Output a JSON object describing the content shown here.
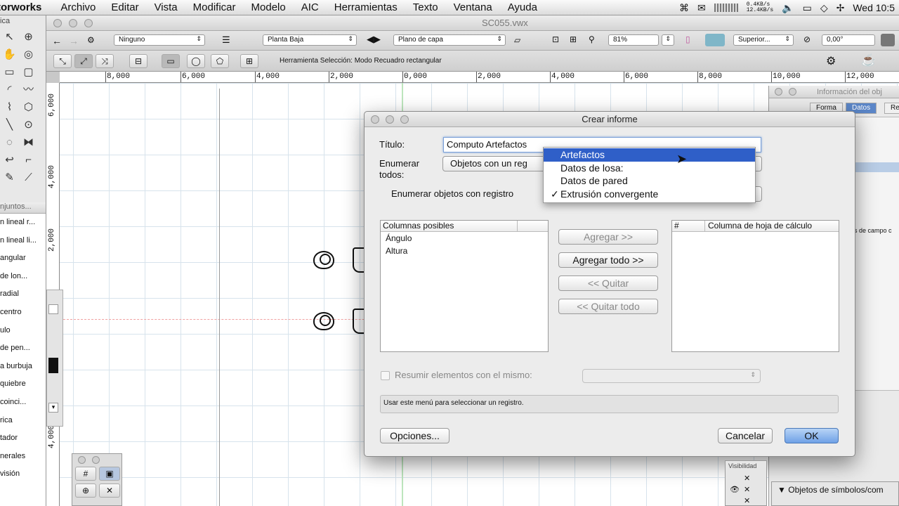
{
  "menubar": {
    "app": "torworks",
    "items": [
      "Archivo",
      "Editar",
      "Vista",
      "Modificar",
      "Modelo",
      "AIC",
      "Herramientas",
      "Texto",
      "Ventana",
      "Ayuda"
    ],
    "net_up": "0.4KB/s",
    "net_down": "12.4KB/s",
    "clock": "Wed 10:5"
  },
  "window": {
    "doc_title": "SC055.vwx"
  },
  "toolbar": {
    "class_popup": "Ninguno",
    "layer_popup": "Planta Baja",
    "layer_plane_popup": "Plano de capa",
    "zoom": "81%",
    "view_popup": "Superior...",
    "rotation": "0,00°",
    "mode_text": "Herramienta Selección: Modo Recuadro rectangular"
  },
  "left_palette": {
    "label_fragment": "ica",
    "sets_header": "njuntos...",
    "sets_items": [
      "n lineal r...",
      "n lineal li...",
      "angular",
      "de lon...",
      "radial",
      "centro",
      "ulo",
      "de pen...",
      "a burbuja",
      "quiebre",
      "coinci...",
      "rica",
      "tador",
      "nerales",
      "visión"
    ]
  },
  "ruler": {
    "top_labels": [
      "8,000",
      "6,000",
      "4,000",
      "2,000",
      "0,000",
      "2,000",
      "4,000",
      "6,000",
      "8,000",
      "10,000",
      "12,000"
    ],
    "left_labels": [
      "6,000",
      "4,000",
      "2,000",
      "4,000"
    ]
  },
  "info_palette": {
    "title": "Información del obj",
    "tabs": [
      "Forma",
      "Datos",
      "Re"
    ],
    "selected_tab": "Datos",
    "row_fragment": "s de campo c"
  },
  "dialog": {
    "title": "Crear informe",
    "titulo_label": "Título:",
    "titulo_value": "Computo Artefactos",
    "enumerar_label": "Enumerar todos:",
    "enumerar_popup": "Objetos con un reg",
    "registro_label": "Enumerar objetos con registro",
    "columns_possible_header": "Columnas posibles",
    "columns_possible": [
      "Ángulo",
      "Altura"
    ],
    "sheet_hash": "#",
    "sheet_header": "Columna de hoja de cálculo",
    "btn_add": "Agregar >>",
    "btn_add_all": "Agregar todo >>",
    "btn_remove": "<< Quitar",
    "btn_remove_all": "<< Quitar todo",
    "summarize_label": "Resumir elementos con el mismo:",
    "status_text": "Usar este menú para seleccionar un registro.",
    "btn_options": "Opciones...",
    "btn_cancel": "Cancelar",
    "btn_ok": "OK"
  },
  "record_menu": {
    "options": [
      "Artefactos",
      "Datos de losa:",
      "Datos de pared",
      "Extrusión convergente"
    ],
    "highlighted": "Artefactos",
    "checked": "Extrusión convergente",
    "checkmark": "✓"
  },
  "bottom": {
    "visibility_label": "Visibilidad",
    "symbols_title": "Objetos de símbolos/com"
  },
  "colors": {
    "highlight": "#2f5fc8",
    "selected_tab": "#5b86c8",
    "default_button": "#6fa1e6"
  }
}
